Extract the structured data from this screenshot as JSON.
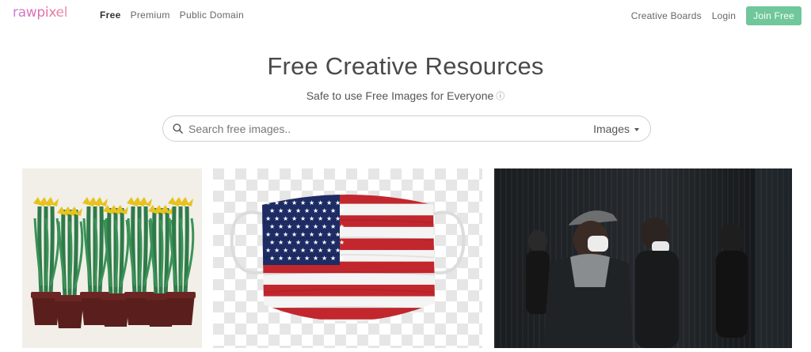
{
  "nav": {
    "logo": "rawpixel",
    "left_links": [
      "Free",
      "Premium",
      "Public Domain"
    ],
    "creative_boards": "Creative Boards",
    "login": "Login",
    "join": "Join Free"
  },
  "hero": {
    "title": "Free Creative Resources",
    "subtitle": "Safe to use Free Images for Everyone",
    "info_icon": "ⓘ"
  },
  "search": {
    "placeholder": "Search free images..",
    "value": "",
    "type": "Images"
  },
  "colors": {
    "brand": "#e26aa3",
    "join_button": "#6fc79a"
  },
  "gallery": {
    "tiles": [
      {
        "subject": "daffodils-in-pots-illustration"
      },
      {
        "subject": "american-flag-face-mask"
      },
      {
        "subject": "people-wearing-face-masks"
      }
    ]
  }
}
